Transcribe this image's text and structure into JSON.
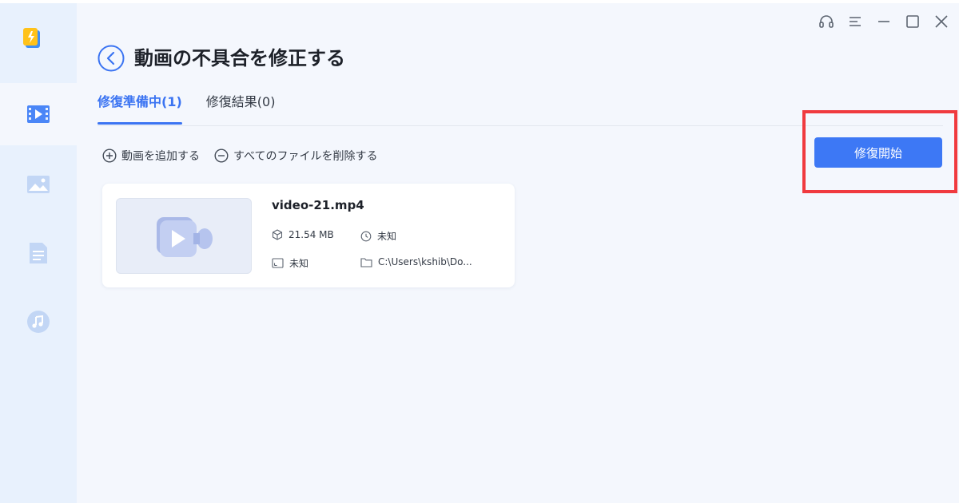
{
  "page": {
    "title": "動画の不具合を修正する"
  },
  "tabs": [
    {
      "label": "修復準備中(1)",
      "active": true
    },
    {
      "label": "修復結果(0)",
      "active": false
    }
  ],
  "actions": {
    "add_video": "動画を追加する",
    "delete_all": "すべてのファイルを削除する"
  },
  "primary_button": {
    "label": "修復開始"
  },
  "file": {
    "name": "video-21.mp4",
    "size": "21.54 MB",
    "duration": "未知",
    "resolution": "未知",
    "path": "C:\\Users\\kshib\\Do..."
  },
  "sidebar": {
    "items": [
      {
        "icon": "video-repair-icon",
        "active": true
      },
      {
        "icon": "photo-repair-icon",
        "active": false
      },
      {
        "icon": "document-repair-icon",
        "active": false
      },
      {
        "icon": "audio-repair-icon",
        "active": false
      }
    ]
  },
  "colors": {
    "accent": "#3b74f2",
    "button": "#3d78f5",
    "highlight": "#f03a3f",
    "sidebar_bg": "#e8f1fd",
    "page_bg": "#f4f7fd"
  }
}
